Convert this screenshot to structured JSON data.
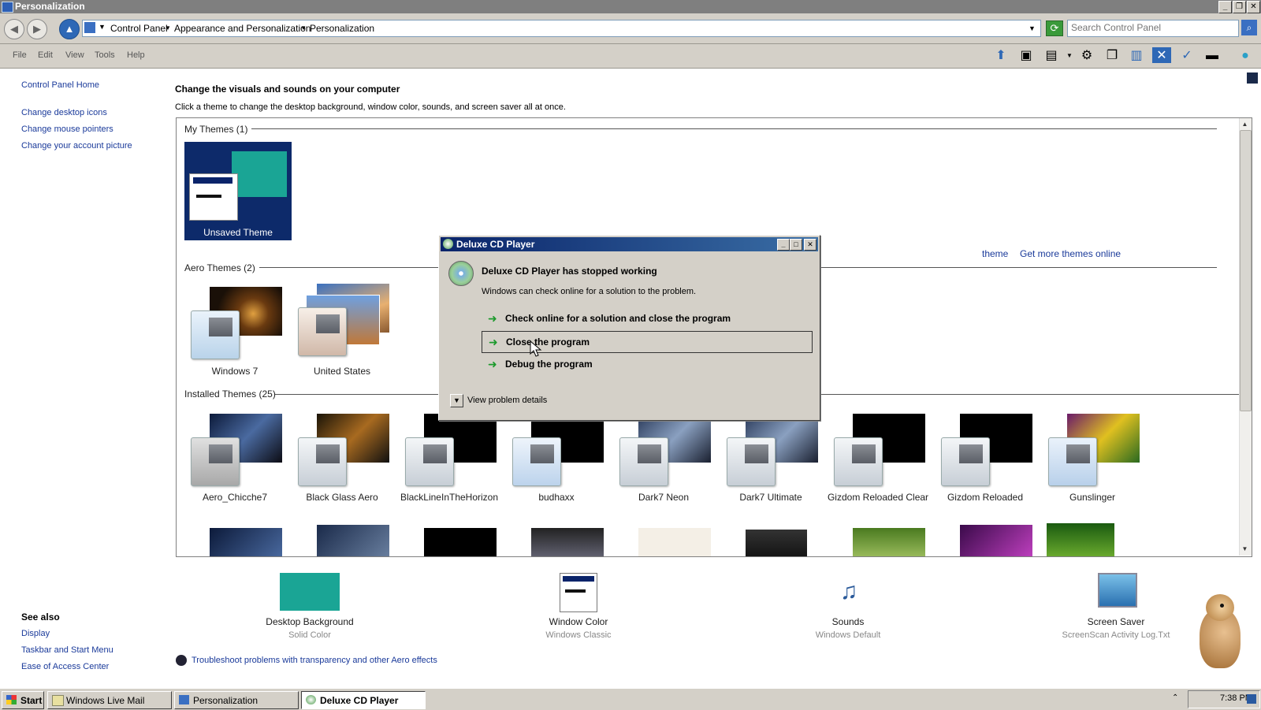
{
  "window": {
    "title": "Personalization"
  },
  "address": {
    "crumbs": [
      "Control Panel",
      "Appearance and Personalization",
      "Personalization"
    ],
    "search_placeholder": "Search Control Panel"
  },
  "menu": [
    "File",
    "Edit",
    "View",
    "Tools",
    "Help"
  ],
  "sidebar": {
    "home": "Control Panel Home",
    "tasks": [
      "Change desktop icons",
      "Change mouse pointers",
      "Change your account picture"
    ],
    "see_also_title": "See also",
    "see_also": [
      "Display",
      "Taskbar and Start Menu",
      "Ease of Access Center"
    ]
  },
  "main": {
    "heading": "Change the visuals and sounds on your computer",
    "subheading": "Click a theme to change the desktop background, window color, sounds, and screen saver all at once.",
    "my_themes": {
      "title": "My Themes (1)",
      "items": [
        "Unsaved Theme"
      ]
    },
    "links": {
      "save_theme_fragment": "theme",
      "get_more": "Get more themes online"
    },
    "aero_themes": {
      "title": "Aero Themes (2)",
      "items": [
        "Windows 7",
        "United States"
      ]
    },
    "installed_themes": {
      "title": "Installed Themes (25)",
      "items": [
        "Aero_Chicche7",
        "Black Glass Aero",
        "BlackLineInTheHorizon",
        "budhaxx",
        "Dark7 Neon",
        "Dark7 Ultimate",
        "Gizdom Reloaded Clear",
        "Gizdom Reloaded",
        "Gunslinger"
      ]
    }
  },
  "bottom": {
    "items": [
      {
        "label": "Desktop Background",
        "sub": "Solid Color"
      },
      {
        "label": "Window Color",
        "sub": "Windows Classic"
      },
      {
        "label": "Sounds",
        "sub": "Windows Default"
      },
      {
        "label": "Screen Saver",
        "sub": "ScreenScan Activity Log.Txt"
      }
    ],
    "troubleshoot": "Troubleshoot problems with transparency and other Aero effects"
  },
  "dialog": {
    "title": "Deluxe CD Player",
    "headline": "Deluxe CD Player has stopped working",
    "message": "Windows can check online for a solution to the problem.",
    "options": [
      "Check online for a solution and close the program",
      "Close the program",
      "Debug the program"
    ],
    "details": "View problem details"
  },
  "taskbar": {
    "start": "Start",
    "tasks": [
      "Windows Live Mail",
      "Personalization",
      "Deluxe CD Player"
    ],
    "clock": "7:38 PM"
  },
  "colors": {
    "desktop_bg_swatch": "#1aa595",
    "dialog_title": "#0a246a",
    "link": "#1a3a9a"
  }
}
